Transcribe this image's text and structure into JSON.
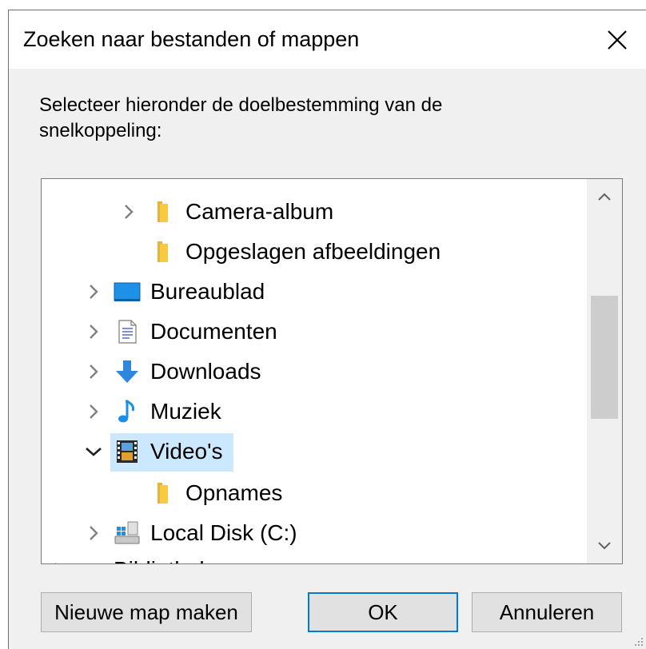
{
  "dialog": {
    "title": "Zoeken naar bestanden of mappen",
    "close_icon": "close-icon",
    "instruction": "Selecteer hieronder de doelbestemming van de snelkoppeling:"
  },
  "tree": {
    "items": [
      {
        "label": "Camera-album",
        "icon": "folder-icon",
        "expander": "collapsed",
        "level": 2,
        "selected": false
      },
      {
        "label": "Opgeslagen afbeeldingen",
        "icon": "folder-icon",
        "expander": "none",
        "level": 2,
        "selected": false
      },
      {
        "label": "Bureaublad",
        "icon": "desktop-icon",
        "expander": "collapsed",
        "level": 1,
        "selected": false
      },
      {
        "label": "Documenten",
        "icon": "documents-icon",
        "expander": "collapsed",
        "level": 1,
        "selected": false
      },
      {
        "label": "Downloads",
        "icon": "download-arrow-icon",
        "expander": "collapsed",
        "level": 1,
        "selected": false
      },
      {
        "label": "Muziek",
        "icon": "music-note-icon",
        "expander": "collapsed",
        "level": 1,
        "selected": false
      },
      {
        "label": "Video's",
        "icon": "film-strip-icon",
        "expander": "expanded",
        "level": 1,
        "selected": true
      },
      {
        "label": "Opnames",
        "icon": "folder-icon",
        "expander": "none",
        "level": 2,
        "selected": false
      },
      {
        "label": "Local Disk (C:)",
        "icon": "drive-icon",
        "expander": "collapsed",
        "level": 1,
        "selected": false
      },
      {
        "label": "Bibliotheken",
        "icon": "library-folder-icon",
        "expander": "collapsed",
        "level": 0,
        "selected": false
      }
    ],
    "scroll_position": 0.35
  },
  "buttons": {
    "new_folder": "Nieuwe map maken",
    "ok": "OK",
    "cancel": "Annuleren"
  },
  "colors": {
    "selection": "#cce8ff",
    "folder": "#f8c943",
    "default_button_border": "#0078d7"
  }
}
